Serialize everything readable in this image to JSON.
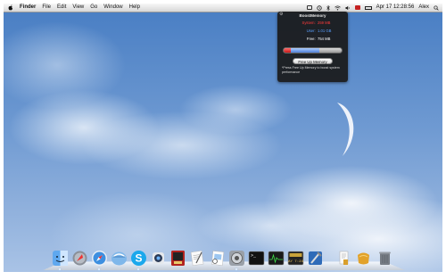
{
  "menubar": {
    "app_name": "Finder",
    "menus": [
      "File",
      "Edit",
      "View",
      "Go",
      "Window",
      "Help"
    ],
    "clock": "Apr 17  12:28:56",
    "user": "Alex"
  },
  "boost_memory": {
    "title": "BoostMemory",
    "stats": [
      {
        "label": "System:",
        "value": "259 MB",
        "color": "#ff3b3b"
      },
      {
        "label": "User:",
        "value": "1.01 GB",
        "color": "#5aa0ff"
      },
      {
        "label": "Free:",
        "value": "754 MB",
        "color": "#ffffff"
      }
    ],
    "button_label": "Free Up Memory",
    "hint": "*Press Free Up Memory to boost system performance",
    "usage_fraction": {
      "system": 0.12,
      "user": 0.5
    }
  },
  "dock": {
    "items": [
      {
        "name": "finder-icon",
        "running": true
      },
      {
        "name": "launchpad-icon",
        "running": false
      },
      {
        "name": "safari-icon",
        "running": true
      },
      {
        "name": "mail-icon",
        "running": false
      },
      {
        "name": "skype-icon",
        "running": true
      },
      {
        "name": "pastebot-icon",
        "running": false
      },
      {
        "name": "photo-booth-icon",
        "running": false
      },
      {
        "name": "textedit-icon",
        "running": false
      },
      {
        "name": "preview-icon",
        "running": false
      },
      {
        "name": "system-preferences-icon",
        "running": true
      },
      {
        "name": "terminal-icon",
        "running": false
      },
      {
        "name": "activity-monitor-icon",
        "running": false
      },
      {
        "name": "console-icon",
        "running": false
      },
      {
        "name": "xcode-icon",
        "running": false
      },
      {
        "name": "documents-stack-icon",
        "running": false
      },
      {
        "name": "downloads-stack-icon",
        "running": false
      },
      {
        "name": "trash-icon",
        "running": false
      }
    ],
    "console_readout": "AY 7:24"
  }
}
